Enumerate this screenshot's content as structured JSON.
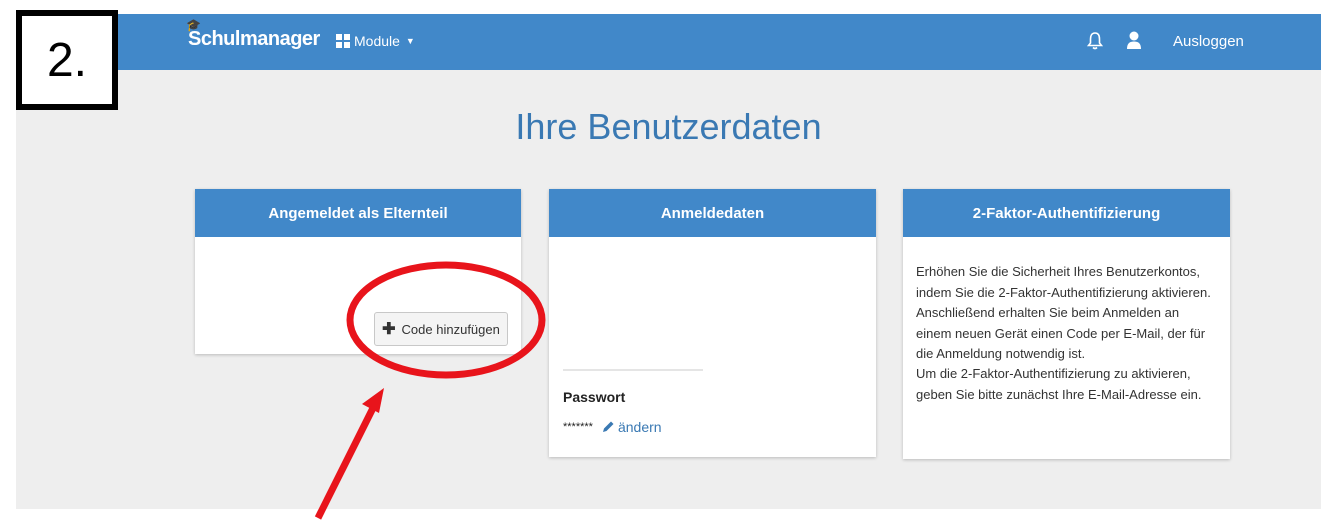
{
  "badge": {
    "label": "2."
  },
  "nav": {
    "brand": "Schulmanager",
    "modules_label": "Module",
    "logout_label": "Ausloggen"
  },
  "page": {
    "title": "Ihre Benutzerdaten"
  },
  "card_parent": {
    "title": "Angemeldet als Elternteil",
    "button_label": "Code hinzufügen"
  },
  "card_login": {
    "title": "Anmeldedaten",
    "password_label": "Passwort",
    "password_value": "*******",
    "change_label": "ändern"
  },
  "card_2fa": {
    "title": "2-Faktor-Authentifizierung",
    "paragraph1": "Erhöhen Sie die Sicherheit Ihres Benutzerkontos, indem Sie die 2-Faktor-Authentifizierung aktivieren. Anschließend erhalten Sie beim Anmelden an einem neuen Gerät einen Code per E-Mail, der für die Anmeldung notwendig ist.",
    "paragraph2": "Um die 2-Faktor-Authentifizierung zu aktivieren, geben Sie bitte zunächst Ihre E-Mail-Adresse ein."
  },
  "colors": {
    "primary": "#4188c9",
    "title": "#3a79b3",
    "annotation": "#e8141b",
    "background": "#eeeeee"
  },
  "icons": {
    "brand": "graduation-cap-icon",
    "modules": "grid-icon",
    "bell": "bell-icon",
    "user": "user-icon",
    "add": "plus-icon",
    "edit": "pencil-icon"
  }
}
